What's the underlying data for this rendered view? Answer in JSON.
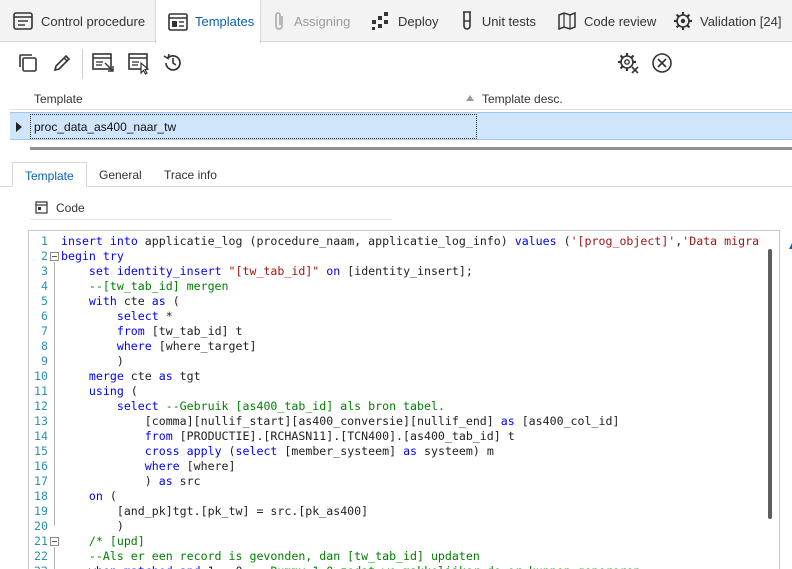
{
  "top_tabs": [
    {
      "label": "Control procedure",
      "icon": "procedure-icon",
      "active": false,
      "disabled": false
    },
    {
      "label": "Templates",
      "icon": "templates-icon",
      "active": true,
      "disabled": false
    },
    {
      "label": "Assigning",
      "icon": "paperclip-icon",
      "active": false,
      "disabled": true
    },
    {
      "label": "Deploy",
      "icon": "deploy-icon",
      "active": false,
      "disabled": false
    },
    {
      "label": "Unit tests",
      "icon": "test-tube-icon",
      "active": false,
      "disabled": false
    },
    {
      "label": "Code review",
      "icon": "map-icon",
      "active": false,
      "disabled": false
    },
    {
      "label": "Validation [24]",
      "icon": "validation-gear-icon",
      "active": false,
      "disabled": false
    }
  ],
  "toolbar": {
    "buttons": [
      "copy-icon",
      "edit-pencil-icon",
      "apply-template-icon",
      "apply-template-cursor-icon",
      "history-icon",
      "settings-gear-icon",
      "close-circle-icon"
    ]
  },
  "grid": {
    "columns": [
      "Template",
      "Template desc."
    ],
    "rows": [
      {
        "template": "proc_data_as400_naar_tw",
        "desc": ""
      }
    ]
  },
  "detail_tabs": [
    {
      "label": "Template",
      "active": true
    },
    {
      "label": "General",
      "active": false
    },
    {
      "label": "Trace info",
      "active": false
    }
  ],
  "code_section": {
    "label": "Code"
  },
  "code_lines": [
    {
      "n": "1",
      "text": "insert into applicatie_log (procedure_naam, applicatie_log_info) values ('[prog_object]','Data migra"
    },
    {
      "n": "2",
      "text": "begin try"
    },
    {
      "n": "3",
      "text": "    set identity_insert \"[tw_tab_id]\" on [identity_insert];"
    },
    {
      "n": "4",
      "text": "    --[tw_tab_id] mergen"
    },
    {
      "n": "5",
      "text": "    with cte as ("
    },
    {
      "n": "6",
      "text": "        select *"
    },
    {
      "n": "7",
      "text": "        from [tw_tab_id] t"
    },
    {
      "n": "8",
      "text": "        where [where_target]"
    },
    {
      "n": "9",
      "text": "        )"
    },
    {
      "n": "10",
      "text": "    merge cte as tgt"
    },
    {
      "n": "11",
      "text": "    using ("
    },
    {
      "n": "12",
      "text": "        select --Gebruik [as400_tab_id] als bron tabel."
    },
    {
      "n": "13",
      "text": "            [comma][nullif_start][as400_conversie][nullif_end] as [as400_col_id]"
    },
    {
      "n": "14",
      "text": "            from [PRODUCTIE].[RCHASN11].[TCN400].[as400_tab_id] t"
    },
    {
      "n": "15",
      "text": "            cross apply (select [member_systeem] as systeem) m"
    },
    {
      "n": "16",
      "text": "            where [where]"
    },
    {
      "n": "17",
      "text": "            ) as src"
    },
    {
      "n": "18",
      "text": "    on ("
    },
    {
      "n": "19",
      "text": "        [and_pk]tgt.[pk_tw] = src.[pk_as400]"
    },
    {
      "n": "20",
      "text": "        )"
    },
    {
      "n": "21",
      "text": "    /* [upd]"
    },
    {
      "n": "22",
      "text": "    --Als er een record is gevonden, dan [tw_tab_id] updaten"
    },
    {
      "n": "23",
      "text": "    when matched and 1 = 0 -- Dummy 1=0 zodat we makkelijker de or kunnen genereren"
    }
  ]
}
